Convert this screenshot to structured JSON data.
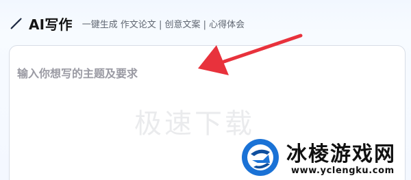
{
  "header": {
    "pen_icon": "magic-pen-icon",
    "title": "AI写作",
    "tagline": "一键生成 作文论文 | 创意文案 | 心得体会"
  },
  "editor": {
    "placeholder": "输入你想写的主题及要求",
    "value": ""
  },
  "watermark": {
    "text": "极速下载"
  },
  "annotation": {
    "arrow_icon": "red-arrow-icon",
    "color": "#e8323c"
  },
  "brand": {
    "logo_icon": "bingleng-logo-icon",
    "name": "冰棱游戏网",
    "url": "www.yclengku.com",
    "colors": {
      "blue": "#1a72d6",
      "dark_blue": "#0f4f9e"
    }
  }
}
